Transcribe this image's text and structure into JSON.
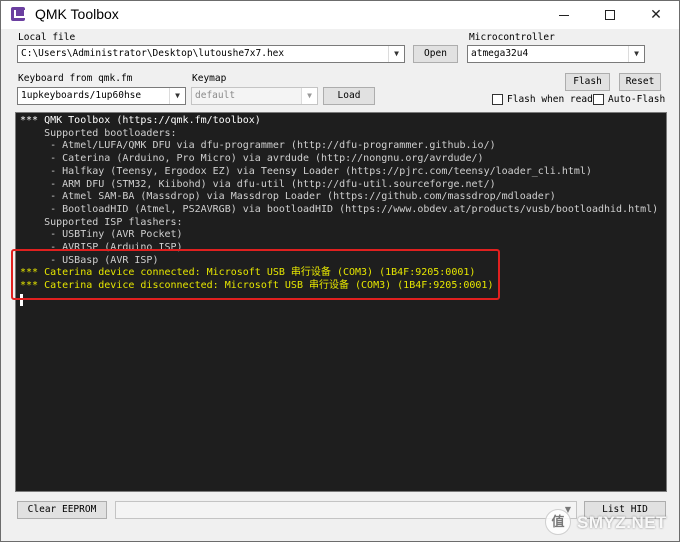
{
  "window": {
    "title": "QMK Toolbox",
    "controls": {
      "minimize": "–",
      "maximize": "□",
      "close": "✕"
    },
    "icon": "qmk-logo-icon"
  },
  "local_file": {
    "label": "Local file",
    "value": "C:\\Users\\Administrator\\Desktop\\lutoushe7x7.hex",
    "open_label": "Open"
  },
  "microcontroller": {
    "label": "Microcontroller",
    "value": "atmega32u4"
  },
  "keyboard": {
    "label": "Keyboard from qmk.fm",
    "value": "1upkeyboards/1up60hse"
  },
  "keymap": {
    "label": "Keymap",
    "value": "default",
    "load_label": "Load"
  },
  "actions": {
    "flash_label": "Flash",
    "reset_label": "Reset",
    "flash_when_ready_label": "Flash when ready",
    "flash_when_ready_checked": false,
    "auto_flash_label": "Auto-Flash",
    "auto_flash_checked": false
  },
  "console": {
    "lines": [
      {
        "text": "*** QMK Toolbox (https://qmk.fm/toolbox)",
        "style": "normal"
      },
      {
        "text": "    Supported bootloaders:",
        "style": "info"
      },
      {
        "text": "     - Atmel/LUFA/QMK DFU via dfu-programmer (http://dfu-programmer.github.io/)",
        "style": "info"
      },
      {
        "text": "     - Caterina (Arduino, Pro Micro) via avrdude (http://nongnu.org/avrdude/)",
        "style": "info"
      },
      {
        "text": "     - Halfkay (Teensy, Ergodox EZ) via Teensy Loader (https://pjrc.com/teensy/loader_cli.html)",
        "style": "info"
      },
      {
        "text": "     - ARM DFU (STM32, Kiibohd) via dfu-util (http://dfu-util.sourceforge.net/)",
        "style": "info"
      },
      {
        "text": "     - Atmel SAM-BA (Massdrop) via Massdrop Loader (https://github.com/massdrop/mdloader)",
        "style": "info"
      },
      {
        "text": "     - BootloadHID (Atmel, PS2AVRGB) via bootloadHID (https://www.obdev.at/products/vusb/bootloadhid.html)",
        "style": "info"
      },
      {
        "text": "    Supported ISP flashers:",
        "style": "info"
      },
      {
        "text": "     - USBTiny (AVR Pocket)",
        "style": "info"
      },
      {
        "text": "     - AVRISP (Arduino ISP)",
        "style": "info"
      },
      {
        "text": "     - USBasp (AVR ISP)",
        "style": "info"
      },
      {
        "text": "*** Caterina device connected: Microsoft USB 串行设备 (COM3) (1B4F:9205:0001)",
        "style": "hl"
      },
      {
        "text": "*** Caterina device disconnected: Microsoft USB 串行设备 (COM3) (1B4F:9205:0001)",
        "style": "hl"
      }
    ],
    "colors": {
      "background": "#1e1e1e",
      "text": "#ffffff",
      "info": "#d0d0d0",
      "highlight": "#e6e600",
      "annotation": "#e0201f"
    }
  },
  "bottom": {
    "clear_eeprom_label": "Clear EEPROM",
    "list_hid_label": "List HID"
  },
  "watermark": {
    "glyph": "值",
    "text": "SMYZ.NET"
  }
}
